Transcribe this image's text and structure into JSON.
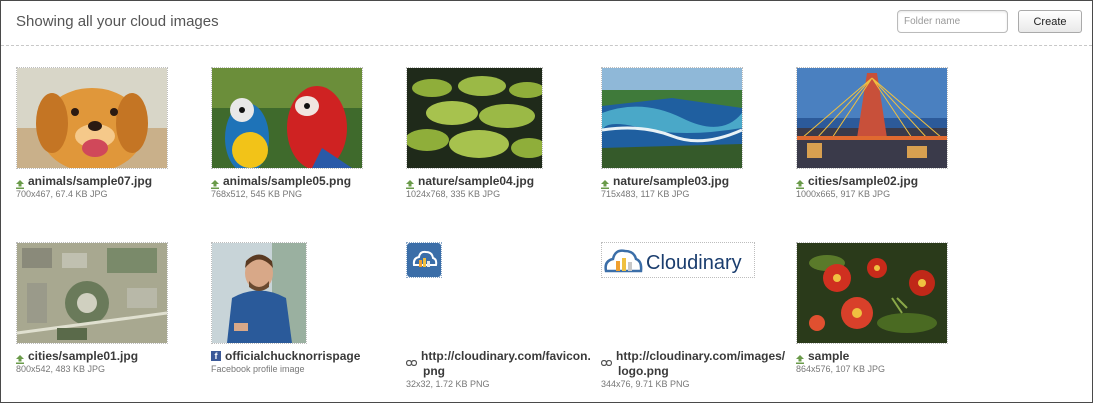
{
  "header": {
    "title": "Showing all your cloud images",
    "folder_placeholder": "Folder name",
    "create_label": "Create"
  },
  "images": [
    {
      "name": "animals/sample07.jpg",
      "meta": "700x467, 67.4 KB JPG",
      "source": "upload-icon"
    },
    {
      "name": "animals/sample05.png",
      "meta": "768x512, 545 KB PNG",
      "source": "upload-icon"
    },
    {
      "name": "nature/sample04.jpg",
      "meta": "1024x768, 335 KB JPG",
      "source": "upload-icon"
    },
    {
      "name": "nature/sample03.jpg",
      "meta": "715x483, 117 KB JPG",
      "source": "upload-icon"
    },
    {
      "name": "cities/sample02.jpg",
      "meta": "1000x665, 917 KB JPG",
      "source": "upload-icon"
    },
    {
      "name": "cities/sample01.jpg",
      "meta": "800x542, 483 KB JPG",
      "source": "upload-icon"
    },
    {
      "name": "officialchucknorrispage",
      "meta": "Facebook profile image",
      "source": "facebook-icon"
    },
    {
      "name_line1": "http://cloudinary.com/favicon.",
      "name_line2": "png",
      "meta": "32x32, 1.72 KB PNG",
      "source": "link-icon"
    },
    {
      "name_line1": "http://cloudinary.com/images/",
      "name_line2": "logo.png",
      "meta": "344x76, 9.71 KB PNG",
      "source": "link-icon"
    },
    {
      "name": "sample",
      "meta": "864x576, 107 KB JPG",
      "source": "upload-icon"
    }
  ],
  "logo_text": "Cloudinary",
  "colors": {
    "brand_blue": "#3b87c8",
    "facebook": "#3b5998",
    "text": "#3a3a3a",
    "meta": "#777777"
  }
}
